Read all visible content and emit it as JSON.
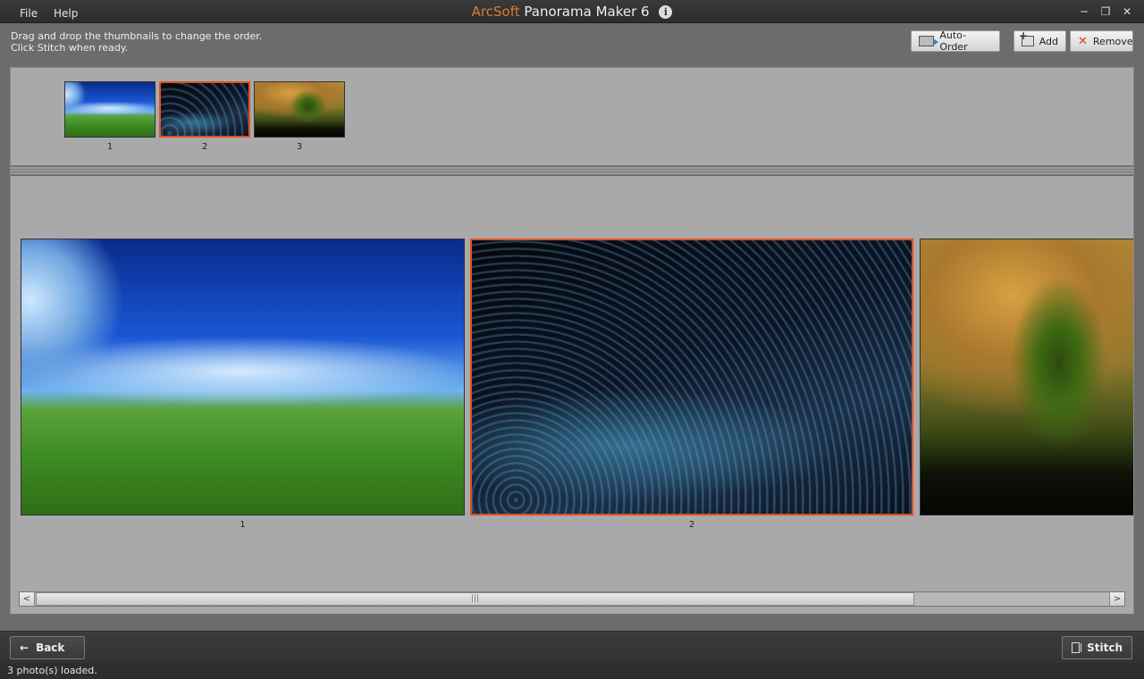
{
  "window": {
    "brand": "ArcSoft",
    "title": "Panorama Maker 6",
    "info_glyph": "i",
    "min_glyph": "─",
    "restore_glyph": "❐",
    "close_glyph": "✕"
  },
  "menu": {
    "file": "File",
    "help": "Help"
  },
  "toolbar": {
    "instruction_line1": "Drag and drop the thumbnails to change the order.",
    "instruction_line2": "Click Stitch when ready.",
    "auto_order_label": "Auto-Order",
    "add_label": "Add",
    "remove_label": "Remove",
    "remove_glyph": "✕"
  },
  "thumbnails": [
    {
      "label": "1",
      "image": "sky-grass-planet",
      "selected": false
    },
    {
      "label": "2",
      "image": "dark-dot-wave",
      "selected": true
    },
    {
      "label": "3",
      "image": "tree-sunset",
      "selected": false
    }
  ],
  "preview": {
    "labels": [
      "1",
      "2"
    ],
    "selected_index": 2
  },
  "scrollbar": {
    "left_glyph": "<",
    "right_glyph": ">",
    "grip_glyph": "|||"
  },
  "bottom": {
    "back_label": "Back",
    "back_glyph": "←",
    "stitch_label": "Stitch"
  },
  "status": {
    "text": "3 photo(s) loaded."
  },
  "colors": {
    "accent": "#e0521c",
    "brand": "#e07a2c"
  }
}
